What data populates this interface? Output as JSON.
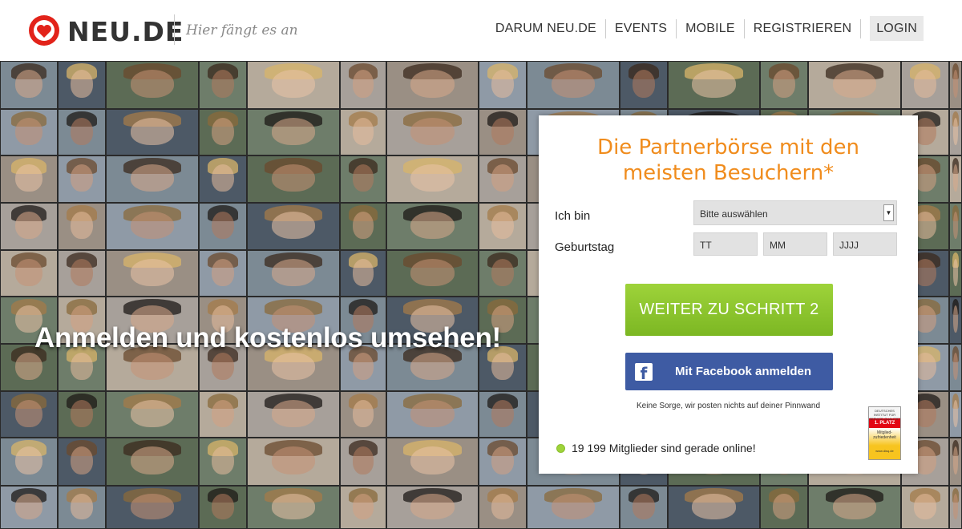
{
  "header": {
    "brand": "NEU.DE",
    "tagline": "Hier fängt es an",
    "nav": [
      "DARUM NEU.DE",
      "EVENTS",
      "MOBILE",
      "REGISTRIEREN"
    ],
    "login": "LOGIN"
  },
  "hero": {
    "headline": "Anmelden und kostenlos umsehen!"
  },
  "panel": {
    "title_line1": "Die Partnerbörse mit den",
    "title_line2": "meisten Besuchern*",
    "gender_label": "Ich bin",
    "gender_select": "Bitte auswählen",
    "birthday_label": "Geburtstag",
    "day_placeholder": "TT",
    "month_placeholder": "MM",
    "year_placeholder": "JJJJ",
    "next_button": "WEITER ZU SCHRITT 2",
    "facebook_button": "Mit Facebook anmelden",
    "facebook_note": "Keine Sorge, wir posten nichts auf deiner Pinnwand",
    "online_status": "19 199 Mitglieder sind gerade online!",
    "award": {
      "header": "DEUTSCHES INSTITUT FÜR SERVICE-QUALITÄT",
      "rank": "1. PLATZ",
      "subtitle": "Mitglied-zufriedenheit",
      "footer": "www.disq.de"
    }
  },
  "colors": {
    "accent_orange": "#f08c1d",
    "button_green": "#8cc42c",
    "facebook_blue": "#3e5ba3",
    "online_dot": "#9ed33a"
  }
}
